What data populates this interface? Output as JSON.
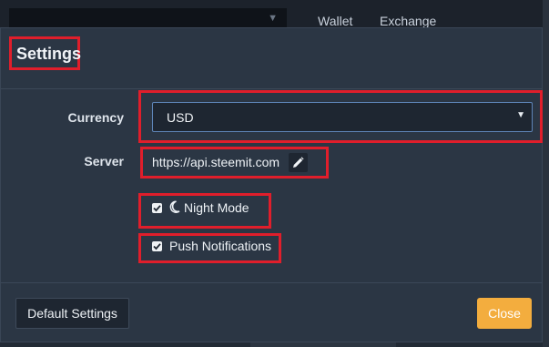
{
  "background": {
    "tabs": [
      "Wallet",
      "Exchange"
    ]
  },
  "modal": {
    "title": "Settings",
    "currency": {
      "label": "Currency",
      "selected": "USD"
    },
    "server": {
      "label": "Server",
      "value": "https://api.steemit.com",
      "edit_icon": "pencil-icon"
    },
    "options": [
      {
        "label": "Night Mode",
        "checked": true,
        "icon": "moon-icon"
      },
      {
        "label": "Push Notifications",
        "checked": true
      }
    ],
    "buttons": {
      "default_settings": "Default Settings",
      "close": "Close"
    }
  },
  "colors": {
    "highlight": "#e01e2b",
    "accent_button": "#f3ad3e",
    "modal_bg": "#2b3644",
    "select_border": "#5e85b8"
  }
}
